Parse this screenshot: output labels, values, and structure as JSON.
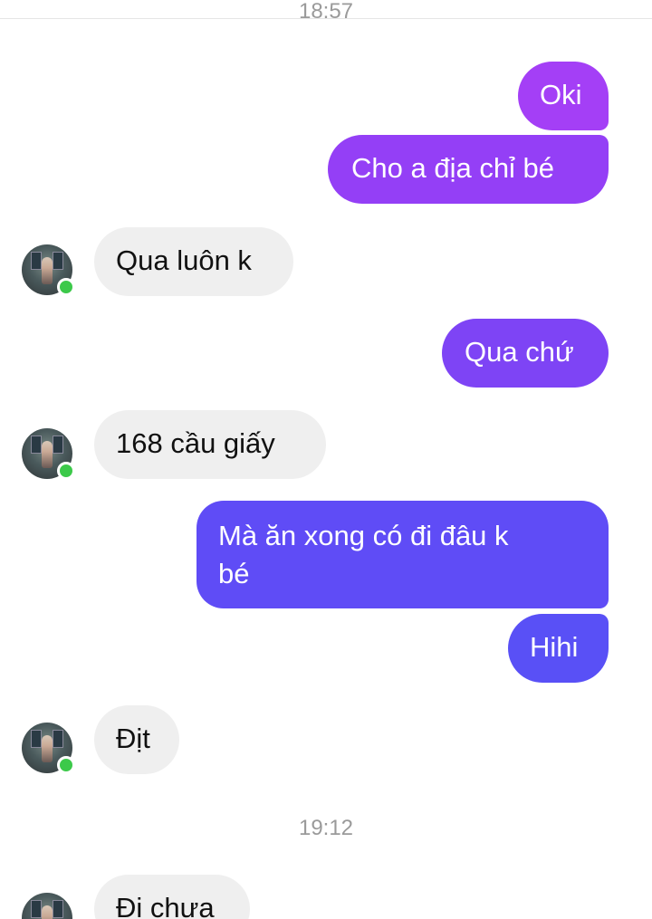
{
  "header": {
    "partial_status": "",
    "timestamp_top": "18:57"
  },
  "messages": [
    {
      "side": "out",
      "text": "Oki"
    },
    {
      "side": "out",
      "text": "Cho a địa chỉ bé"
    },
    {
      "side": "in",
      "text": "Qua luôn k"
    },
    {
      "side": "out",
      "text": "Qua chứ"
    },
    {
      "side": "in",
      "text": "168 cầu giấy"
    },
    {
      "side": "out",
      "text": "Mà ăn xong có đi đâu k\nbé"
    },
    {
      "side": "out",
      "text": "Hihi"
    },
    {
      "side": "in",
      "text": "Địt"
    },
    {
      "side": "in",
      "text": "Đi chưa"
    }
  ],
  "timestamp_mid": "19:12",
  "colors": {
    "out_top": "#9a3ff6",
    "out_mid": "#7c45f5",
    "out_bottom": "#5b4cf6",
    "incoming_bg": "#efefef",
    "online_dot": "#3cc94a"
  },
  "contact": {
    "avatar_icon": "contact-avatar",
    "online": true
  }
}
